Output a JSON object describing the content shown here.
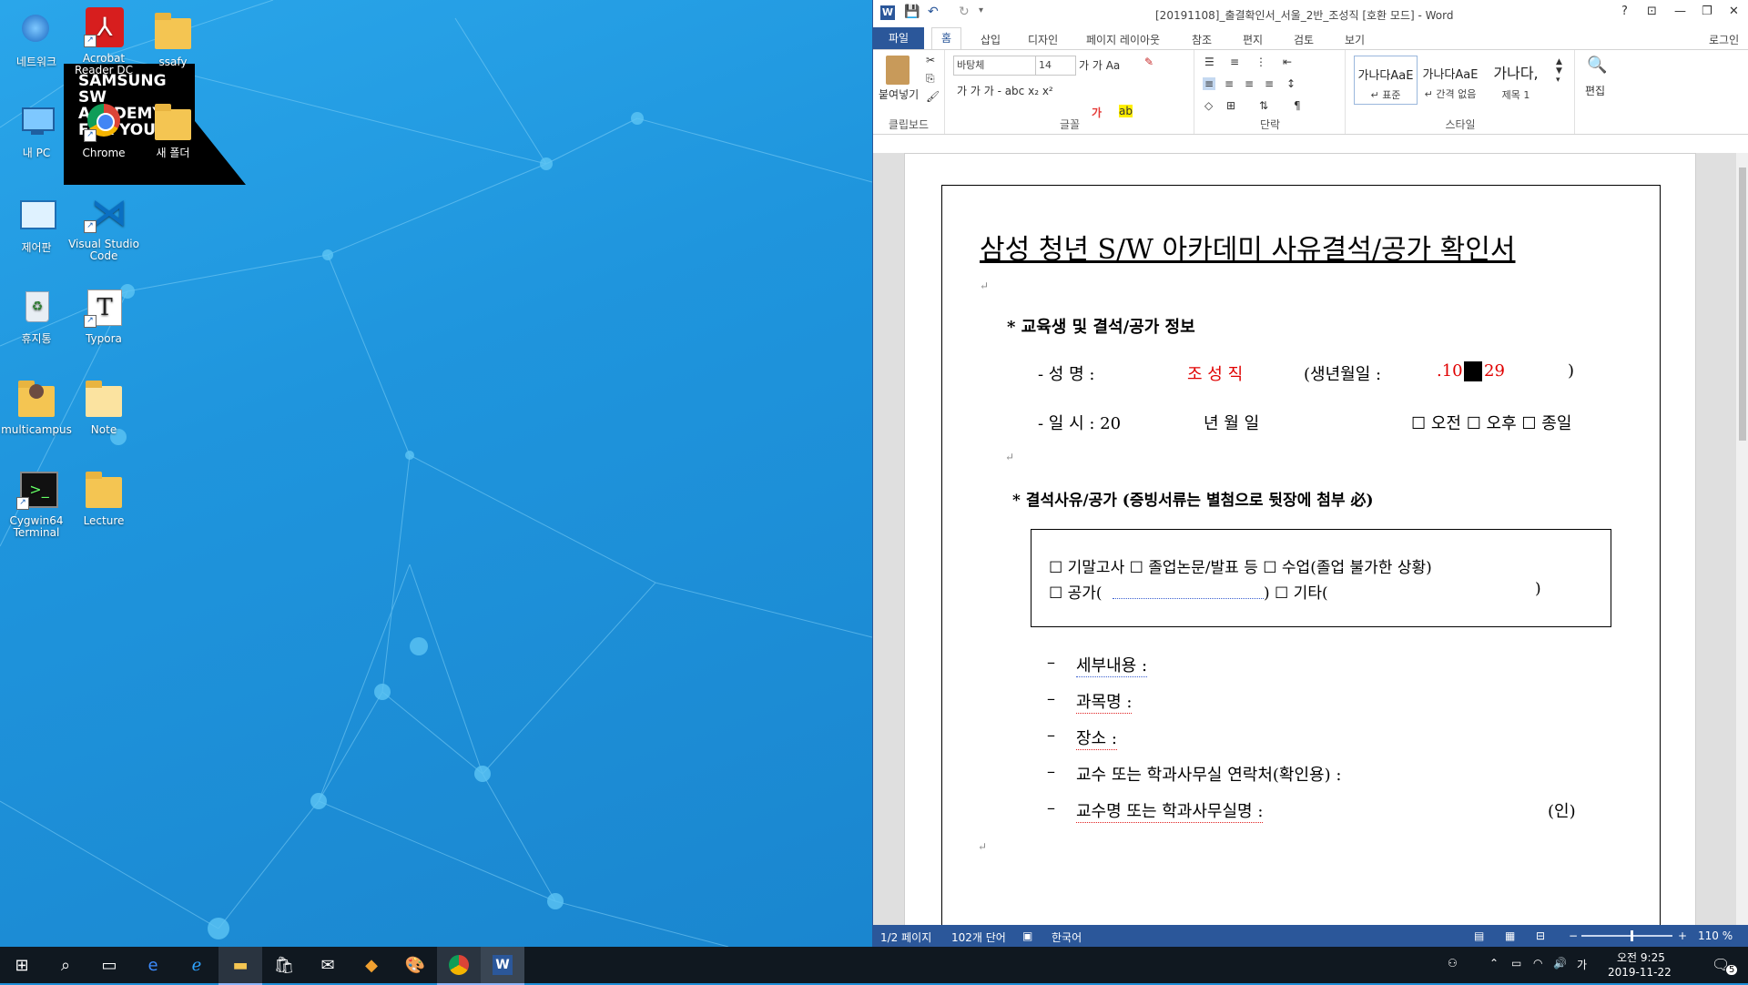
{
  "desktop": {
    "icons": [
      {
        "label": "네트워크"
      },
      {
        "label": "Acrobat Reader DC"
      },
      {
        "label": "ssafy"
      },
      {
        "label": "내 PC"
      },
      {
        "label": "Chrome"
      },
      {
        "label": "새 폴더"
      },
      {
        "label": "제어판"
      },
      {
        "label": "Visual Studio Code"
      },
      {
        "label": "휴지통"
      },
      {
        "label": "Typora"
      },
      {
        "label": "multicampus"
      },
      {
        "label": "Note"
      },
      {
        "label": "Cygwin64 Terminal"
      },
      {
        "label": "Lecture"
      }
    ],
    "banner_text": "SAMSUNG SW ACADEMY FOR YOUTH"
  },
  "word": {
    "title": "[20191108]_출결확인서_서울_2반_조성직 [호환 모드] - Word",
    "help": "?",
    "tabs": [
      "파일",
      "홈",
      "삽입",
      "디자인",
      "페이지 레이아웃",
      "참조",
      "편지",
      "검토",
      "보기"
    ],
    "login": "로그인",
    "ribbon": {
      "clipboard": {
        "paste": "붙여넣기",
        "label": "클립보드"
      },
      "font": {
        "name": "바탕체",
        "size": "14",
        "label": "글꼴",
        "row1": "가 가  Aa",
        "row2": "가 가 가 - abc x₂ x²"
      },
      "paragraph": {
        "label": "단락"
      },
      "styles": {
        "label": "스타일",
        "items": [
          {
            "preview": "가나다AaE",
            "name": "↵ 표준"
          },
          {
            "preview": "가나다AaE",
            "name": "↵ 간격 없음"
          },
          {
            "preview": "가나다,",
            "name": "제목 1"
          }
        ]
      },
      "edit": {
        "label": "편집"
      }
    },
    "doc": {
      "title": "삼성 청년 S/W 아카데미 사유결석/공가 확인서",
      "section1": "* 교육생 및 결석/공가 정보",
      "name_label": "- 성      명 :",
      "name_value": "조 성 직",
      "birth_label": "(생년월일 :",
      "birth_value_a": ".10",
      "birth_value_b": "29",
      "birth_close": ")",
      "date_label": "- 일      시 : 20",
      "date_units": "년      월      일",
      "date_opts": "☐ 오전 ☐ 오후 ☐ 종일",
      "section2": "* 결석사유/공가 (증빙서류는 별첨으로 뒷장에 첨부 必)",
      "box_line1": "☐ 기말고사    ☐ 졸업논문/발표 등 ☐ 수업(졸업 불가한 상황)",
      "box_line2a": "☐ 공가(",
      "box_line2b": ")      ☐ 기타(",
      "box_line2c": ")",
      "items": [
        "세부내용 :",
        "과목명 :",
        "장소 :",
        "교수 또는 학과사무실 연락처(확인용) :",
        "교수명 또는 학과사무실명 :"
      ],
      "sign": "(인)"
    },
    "status": {
      "page": "1/2 페이지",
      "words": "102개 단어",
      "lang": "한국어",
      "zoom": "110 %"
    }
  },
  "taskbar": {
    "time": "오전 9:25",
    "date": "2019-11-22",
    "ime": "가",
    "notifications": "5"
  }
}
